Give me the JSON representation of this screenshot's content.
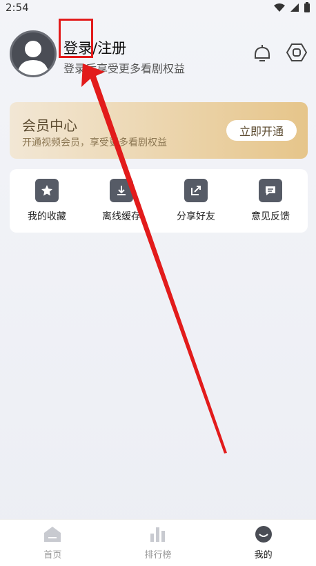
{
  "status": {
    "time": "2:54"
  },
  "header": {
    "title": "登录/注册",
    "subtitle": "登录后享受更多看剧权益"
  },
  "vip": {
    "title": "会员中心",
    "subtitle": "开通视频会员，享受更多看剧权益",
    "button": "立即开通"
  },
  "quick_actions": [
    {
      "label": "我的收藏",
      "icon": "star-icon"
    },
    {
      "label": "离线缓存",
      "icon": "download-icon"
    },
    {
      "label": "分享好友",
      "icon": "share-icon"
    },
    {
      "label": "意见反馈",
      "icon": "feedback-icon"
    }
  ],
  "tabs": [
    {
      "label": "首页",
      "icon": "home-icon"
    },
    {
      "label": "排行榜",
      "icon": "chart-icon"
    },
    {
      "label": "我的",
      "icon": "profile-icon"
    }
  ],
  "annotation_color": "#e21b1b"
}
